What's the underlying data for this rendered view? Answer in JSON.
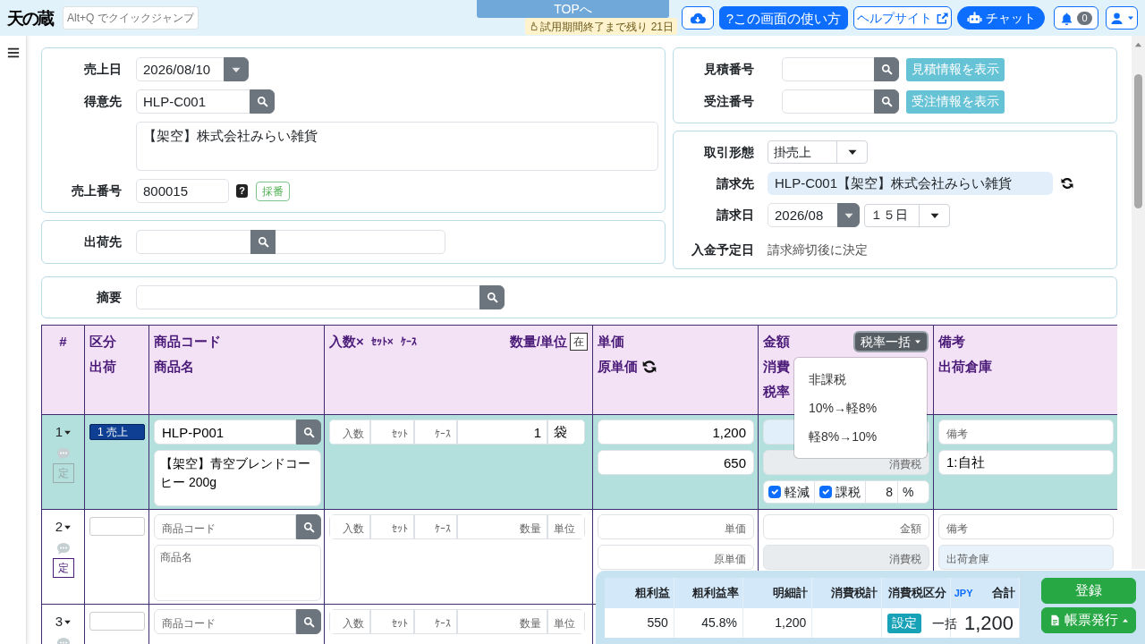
{
  "header": {
    "logo": "天の蔵",
    "quick_jump": {
      "placeholder": "Alt+Q でクイックジャンプ"
    },
    "top_link": "TOPへ",
    "trial_notice": "試用期間終了まで残り 21日",
    "help_button": "?この画面の使い方",
    "help_site_button": "ヘルプサイト",
    "chat_button": "チャット",
    "notification_count": "0"
  },
  "sales": {
    "date": {
      "label": "売上日",
      "value": "2026/08/10"
    },
    "customer": {
      "label": "得意先",
      "code": "HLP-C001",
      "name": "【架空】株式会社みらい雑貨"
    },
    "number": {
      "label": "売上番号",
      "value": "800015",
      "help": "?",
      "assign_button": "採番"
    }
  },
  "ship_to": {
    "label": "出荷先"
  },
  "references": [
    {
      "label": "見積番号",
      "button": "見積情報を表示"
    },
    {
      "label": "受注番号",
      "button": "受注情報を表示"
    }
  ],
  "billing": {
    "transaction_type": {
      "label": "取引形態",
      "value": "掛売上"
    },
    "bill_to": {
      "label": "請求先",
      "value": "HLP-C001【架空】株式会社みらい雑貨"
    },
    "billing_date": {
      "label": "請求日",
      "month": "2026/08",
      "day": "１５日"
    },
    "payment_date": {
      "label": "入金予定日",
      "value": "請求締切後に決定"
    }
  },
  "memo": {
    "label": "摘要"
  },
  "table": {
    "columns": [
      {
        "kind": "plain",
        "lines": [
          "#"
        ]
      },
      {
        "kind": "plain",
        "lines": [
          "区分",
          "出荷"
        ]
      },
      {
        "kind": "plain",
        "lines": [
          "商品コード",
          "商品名"
        ]
      },
      {
        "kind": "quantity",
        "parts": [
          "入数×",
          "ｾｯﾄ×",
          "ｹｰｽ"
        ],
        "right": "数量/単位",
        "stock_button": "在"
      },
      {
        "kind": "price",
        "lines": [
          "単価",
          "原単価"
        ]
      },
      {
        "kind": "amount",
        "lines": [
          "金額",
          "消費",
          "税率"
        ]
      },
      {
        "kind": "plain",
        "lines": [
          "備考",
          "出荷倉庫"
        ]
      }
    ],
    "tax_menu": {
      "label": "税率一括",
      "open": true,
      "items": [
        "非課税",
        "10%→軽8%",
        "軽8%→10%"
      ]
    },
    "rows": [
      {
        "number": "1",
        "selected": true,
        "fix_button": {
          "label": "定",
          "disabled": true
        },
        "category": "1 売上",
        "code": {
          "value": "HLP-P001"
        },
        "name": {
          "value": "【架空】青空ブレンドコーヒー 200g"
        },
        "qty_parts": [
          {
            "placeholder": "入数"
          },
          {
            "placeholder": "ｾｯﾄ"
          },
          {
            "placeholder": "ｹｰｽ"
          }
        ],
        "quantity": {
          "value": "1"
        },
        "unit": {
          "value": "袋"
        },
        "price": {
          "value": "1,200"
        },
        "cost": {
          "value": "650"
        },
        "amount": {
          "highlighted": true
        },
        "tax": {
          "placeholder": "消費税"
        },
        "tax_options": {
          "reduced": {
            "label": "軽減",
            "checked": true
          },
          "taxable": {
            "label": "課税",
            "checked": true
          },
          "rate": "8",
          "unit": "%"
        },
        "note": {
          "placeholder": "備考"
        },
        "warehouse": {
          "value": "1:自社"
        }
      },
      {
        "number": "2",
        "selected": false,
        "fix_button": {
          "label": "定",
          "disabled": false
        },
        "code": {
          "placeholder": "商品コード"
        },
        "name": {
          "placeholder": "商品名"
        },
        "qty_parts": [
          {
            "placeholder": "入数"
          },
          {
            "placeholder": "ｾｯﾄ"
          },
          {
            "placeholder": "ｹｰｽ"
          }
        ],
        "quantity": {
          "placeholder": "数量"
        },
        "unit": {
          "placeholder": "単位"
        },
        "price": {
          "placeholder": "単価"
        },
        "cost": {
          "placeholder": "原単価"
        },
        "amount": {
          "placeholder": "金額",
          "highlighted": false
        },
        "tax": {
          "placeholder": "消費税"
        },
        "note": {
          "placeholder": "備考"
        },
        "warehouse": {
          "placeholder": "出荷倉庫"
        }
      },
      {
        "number": "3",
        "selected": false,
        "code": {
          "placeholder": "商品コード"
        },
        "qty_parts": [
          {
            "placeholder": "入数"
          },
          {
            "placeholder": "ｾｯﾄ"
          },
          {
            "placeholder": "ｹｰｽ"
          }
        ],
        "quantity": {
          "placeholder": "数量"
        },
        "unit": {
          "placeholder": "単位"
        }
      }
    ]
  },
  "summary": {
    "headers": [
      "粗利益",
      "粗利益率",
      "明細計",
      "消費税計",
      "消費税区分"
    ],
    "currency": "JPY",
    "total_label": "合計",
    "values": [
      "550",
      "45.8%",
      "1,200"
    ],
    "tax_setting_button": "設定",
    "tax_mode": "一括",
    "total": "1,200",
    "register_button": "登録",
    "print_button": "帳票発行"
  }
}
